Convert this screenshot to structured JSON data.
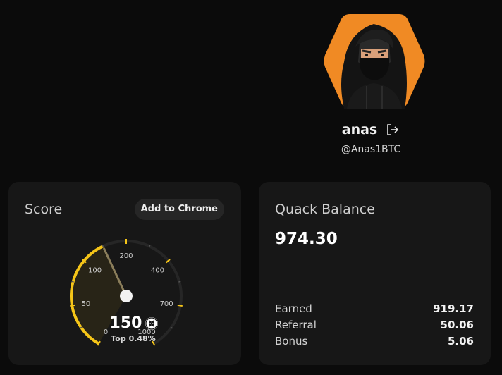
{
  "profile": {
    "name": "anas",
    "handle": "@Anas1BTC",
    "avatar": "hooded-figure-avatar",
    "avatar_bg": "#f08a24"
  },
  "score_card": {
    "title": "Score",
    "add_button": "Add to Chrome",
    "gauge": {
      "value": 150,
      "max": 1000,
      "ticks": [
        "0",
        "50",
        "100",
        "200",
        "400",
        "700",
        "1000"
      ],
      "accent": "#f5c518"
    },
    "score": "150",
    "rank": "Top 0.48%"
  },
  "balance_card": {
    "title": "Quack Balance",
    "total": "974.30",
    "rows": [
      {
        "label": "Earned",
        "value": "919.17"
      },
      {
        "label": "Referral",
        "value": "50.06"
      },
      {
        "label": "Bonus",
        "value": "5.06"
      }
    ]
  }
}
